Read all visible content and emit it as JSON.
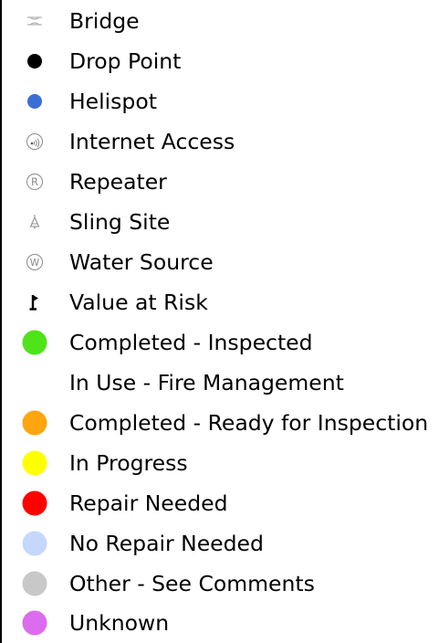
{
  "legend": {
    "items": [
      {
        "label": "Bridge",
        "icon": "bridge-icon"
      },
      {
        "label": "Drop Point",
        "icon": "drop-point-icon",
        "color": "#000000"
      },
      {
        "label": "Helispot",
        "icon": "helispot-icon",
        "color": "#3c6fd6"
      },
      {
        "label": "Internet Access",
        "icon": "internet-access-icon"
      },
      {
        "label": "Repeater",
        "icon": "repeater-icon"
      },
      {
        "label": "Sling Site",
        "icon": "sling-site-icon"
      },
      {
        "label": "Water Source",
        "icon": "water-source-icon"
      },
      {
        "label": "Value at Risk",
        "icon": "value-at-risk-icon"
      },
      {
        "label": "Completed - Inspected",
        "icon": "status-dot-icon",
        "color": "#4fe31a"
      },
      {
        "label": "In Use - Fire Management",
        "icon": "none"
      },
      {
        "label": "Completed - Ready for Inspection",
        "icon": "status-dot-icon",
        "color": "#fda60f"
      },
      {
        "label": "In Progress",
        "icon": "status-dot-icon",
        "color": "#ffff00"
      },
      {
        "label": "Repair Needed",
        "icon": "status-dot-icon",
        "color": "#ff0000"
      },
      {
        "label": "No Repair Needed",
        "icon": "status-dot-icon",
        "color": "#c5d8fb"
      },
      {
        "label": "Other - See Comments",
        "icon": "status-dot-icon",
        "color": "#c8c8c8"
      },
      {
        "label": "Unknown",
        "icon": "status-dot-icon",
        "color": "#dc6cef"
      }
    ]
  }
}
